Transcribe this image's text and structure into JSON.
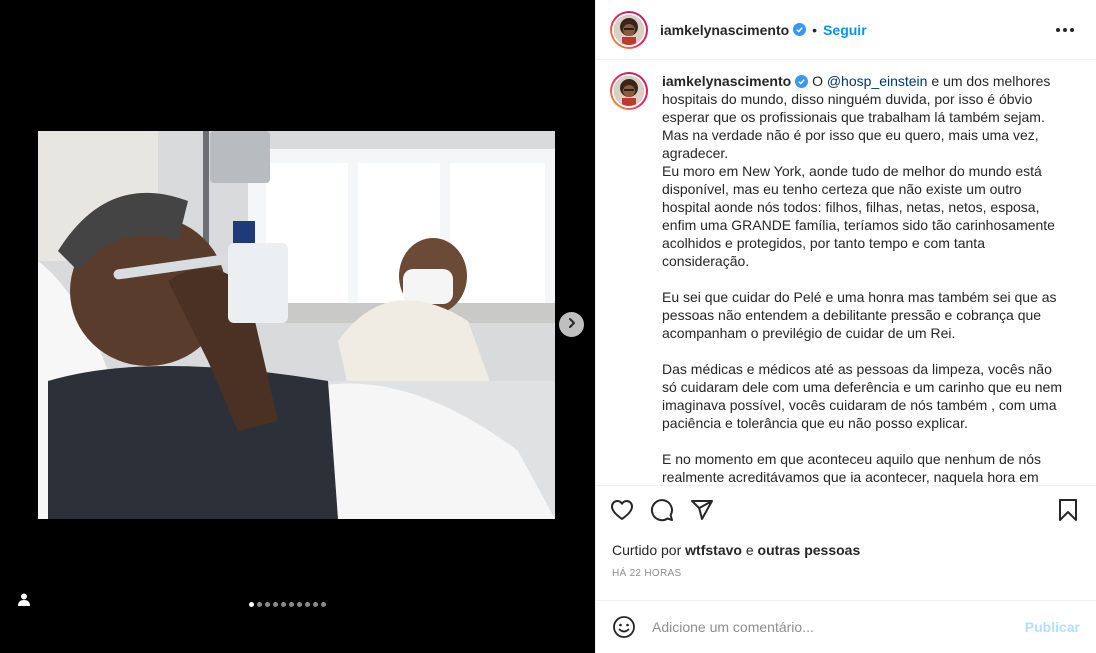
{
  "post": {
    "username": "iamkelynascimento",
    "separator": "•",
    "follow_label": "Seguir"
  },
  "caption": {
    "username": "iamkelynascimento",
    "lead": "O ",
    "mention": "@hosp_einstein",
    "paragraph1": " e um dos melhores hospitais do mundo, disso ninguém duvida, por isso é óbvio esperar que os profissionais que trabalham lá também sejam. Mas na verdade não é por isso que eu quero, mais uma vez, agradecer.\nEu moro em New York, aonde tudo de melhor do mundo está disponível, mas eu tenho certeza que não existe um outro hospital aonde nós todos: filhos, filhas, netas, netos, esposa, enfim uma GRANDE família, teríamos sido tão carinhosamente acolhidos e protegidos, por tanto tempo e com tanta consideração.",
    "paragraph2": "Eu sei que cuidar do Pelé e uma honra mas também sei que as pessoas não entendem a debilitante pressão e cobrança que acompanham o previlégio de cuidar de um Rei.",
    "paragraph3": "Das médicas e médicos até as pessoas da limpeza, vocês não só cuidaram dele com uma deferência e um carinho que eu nem imaginava possível, vocês cuidaram de nós também , com uma paciência e tolerância que eu não posso explicar.",
    "paragraph4": "E no momento em que aconteceu aquilo que nenhum de nós realmente acreditávamos que ia acontecer, naquela hora em que"
  },
  "likes": {
    "prefix": "Curtido por ",
    "user": "wtfstavo",
    "middle": " e ",
    "others": "outras pessoas"
  },
  "timestamp": "HÁ 22 HORAS",
  "comment": {
    "placeholder": "Adicione um comentário...",
    "publish_label": "Publicar"
  },
  "carousel": {
    "count": 10,
    "active_index": 0
  },
  "icons": {
    "like": "heart-icon",
    "comment": "comment-bubble-icon",
    "share": "paper-plane-icon",
    "save": "bookmark-icon",
    "emoji": "smiley-icon",
    "next": "chevron-right-icon",
    "tag": "user-tag-icon",
    "verified": "verified-badge-icon",
    "more": "more-options-icon"
  },
  "colors": {
    "accent": "#0095f6",
    "verified": "#3897f0",
    "publish_disabled": "#b2dffc",
    "muted": "#8e8e8e"
  }
}
